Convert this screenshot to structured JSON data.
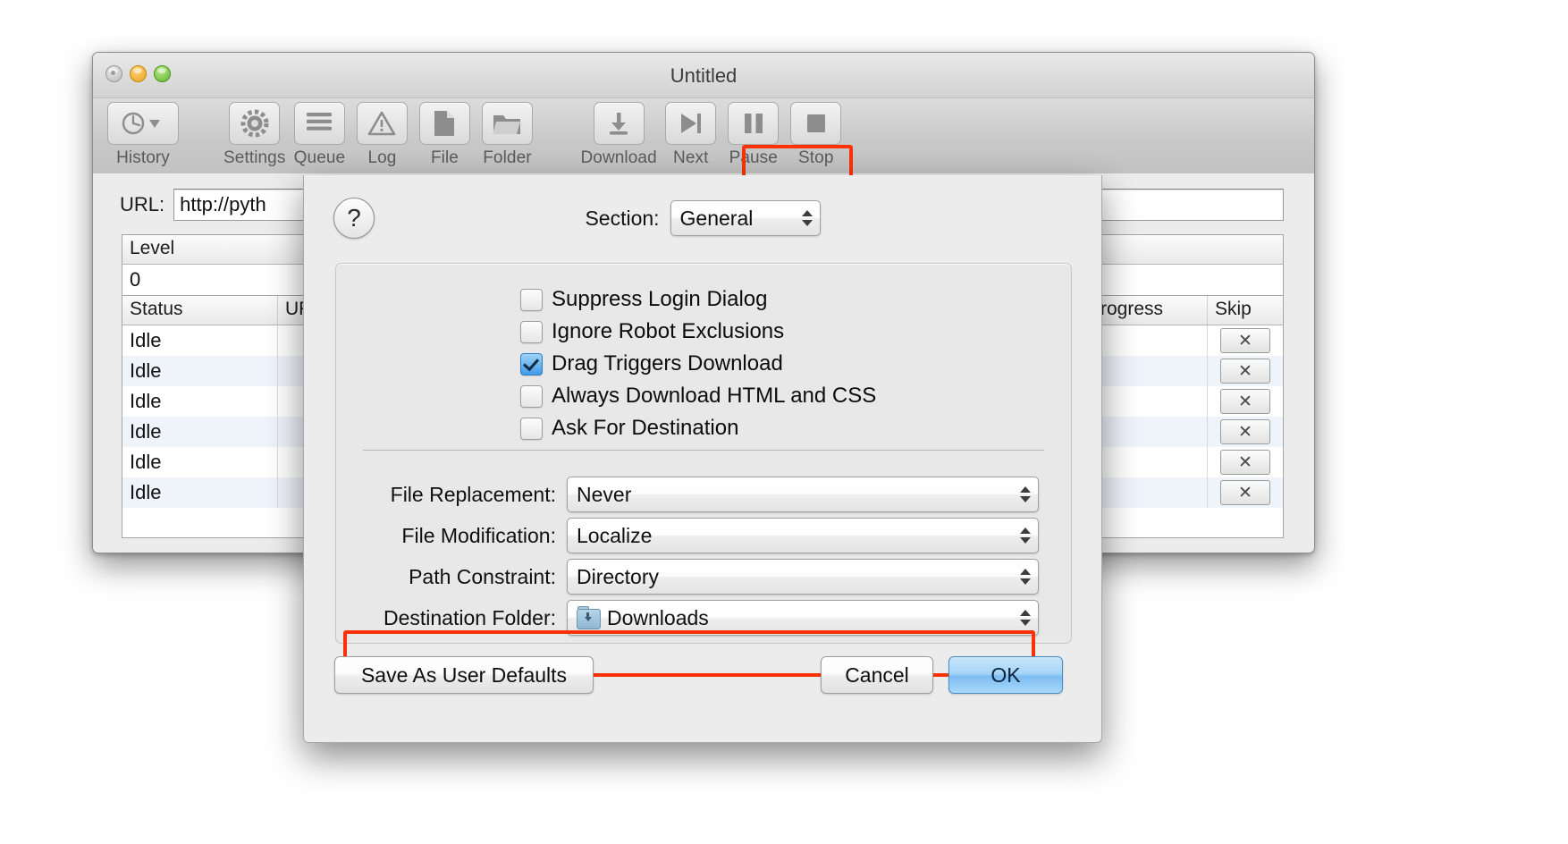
{
  "window": {
    "title": "Untitled",
    "traffic_lights": [
      "close",
      "minimize",
      "zoom"
    ]
  },
  "toolbar": {
    "items": [
      {
        "label": "History",
        "icon": "history-clock-icon"
      },
      {
        "label": "Settings",
        "icon": "gear-icon"
      },
      {
        "label": "Queue",
        "icon": "list-lines-icon"
      },
      {
        "label": "Log",
        "icon": "warning-triangle-icon"
      },
      {
        "label": "File",
        "icon": "document-icon"
      },
      {
        "label": "Folder",
        "icon": "folder-icon"
      },
      {
        "label": "Download",
        "icon": "download-arrow-icon"
      },
      {
        "label": "Next",
        "icon": "next-skip-icon"
      },
      {
        "label": "Pause",
        "icon": "pause-icon"
      },
      {
        "label": "Stop",
        "icon": "stop-square-icon"
      }
    ],
    "highlight_color": "#f93208",
    "highlighted_item": "Download"
  },
  "main": {
    "url_label": "URL:",
    "url_value": "http://pyth",
    "level_table": {
      "headers": [
        "Level",
        "",
        ""
      ],
      "rows": [
        [
          "0",
          "",
          ""
        ]
      ]
    },
    "queue_table": {
      "headers": [
        "Status",
        "URL",
        "Progress",
        "Skip"
      ],
      "rows": [
        {
          "status": "Idle",
          "url": "",
          "progress": "",
          "skip": "✕"
        },
        {
          "status": "Idle",
          "url": "",
          "progress": "",
          "skip": "✕"
        },
        {
          "status": "Idle",
          "url": "",
          "progress": "",
          "skip": "✕"
        },
        {
          "status": "Idle",
          "url": "",
          "progress": "",
          "skip": "✕"
        },
        {
          "status": "Idle",
          "url": "",
          "progress": "",
          "skip": "✕"
        },
        {
          "status": "Idle",
          "url": "",
          "progress": "",
          "skip": "✕"
        }
      ]
    }
  },
  "dialog": {
    "help_label": "?",
    "section_label": "Section:",
    "section_value": "General",
    "checkboxes": [
      {
        "label": "Suppress Login Dialog",
        "checked": false
      },
      {
        "label": "Ignore Robot Exclusions",
        "checked": false
      },
      {
        "label": "Drag Triggers Download",
        "checked": true
      },
      {
        "label": "Always Download HTML and CSS",
        "checked": false
      },
      {
        "label": "Ask For Destination",
        "checked": false
      }
    ],
    "fields": [
      {
        "label": "File Replacement:",
        "value": "Never",
        "highlighted": false
      },
      {
        "label": "File Modification:",
        "value": "Localize",
        "highlighted": false
      },
      {
        "label": "Path Constraint:",
        "value": "Directory",
        "highlighted": true
      },
      {
        "label": "Destination Folder:",
        "value": "Downloads",
        "icon": "downloads-folder-icon",
        "highlighted": false
      }
    ],
    "buttons": {
      "save_defaults": "Save As User Defaults",
      "cancel": "Cancel",
      "ok": "OK"
    },
    "accent_color": "#f93208",
    "default_button_color": "#7dbdf2"
  }
}
